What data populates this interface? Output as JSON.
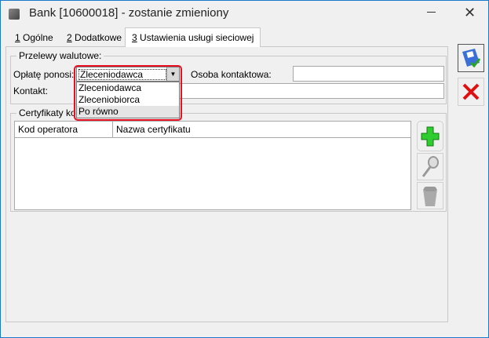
{
  "window": {
    "title": "Bank [10600018] - zostanie zmieniony",
    "minimize": "—",
    "close": "✕"
  },
  "tabs": [
    {
      "num": "1",
      "label": " Ogólne"
    },
    {
      "num": "2",
      "label": " Dodatkowe"
    },
    {
      "num": "3",
      "label": " Ustawienia usługi sieciowej"
    }
  ],
  "przelewy": {
    "legend": "Przelewy walutowe:",
    "oplate_label": "Opłatę ponosi:",
    "oplate_value": "Zleceniodawca",
    "options": [
      "Zleceniodawca",
      "Zleceniobiorca",
      "Po równo"
    ],
    "osoba_label": "Osoba kontaktowa:",
    "osoba_value": "",
    "kontakt_label": "Kontakt:",
    "kontakt_value": ""
  },
  "certyfikaty": {
    "legend": "Certyfikaty kontrahenta",
    "columns": [
      "Kod operatora",
      "Nazwa certyfikatu"
    ]
  },
  "colors": {
    "accent": "#e81123",
    "border": "#1979ca"
  }
}
